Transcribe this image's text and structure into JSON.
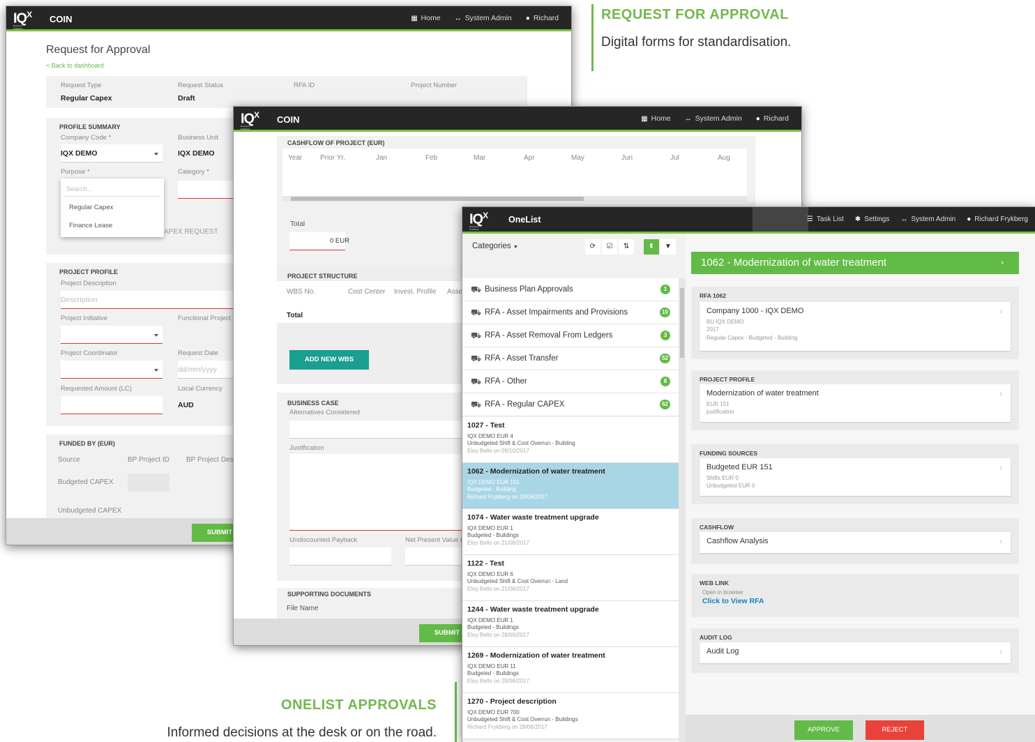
{
  "heading_rfa": {
    "title": "REQUEST FOR APPROVAL",
    "subtitle": "Digital forms for standardisation."
  },
  "heading_onelist": {
    "title": "ONELIST APPROVALS",
    "subtitle": "Informed decisions at the desk or on the road."
  },
  "colors": {
    "accent": "#62bb46",
    "heading": "#72b84e",
    "topbar": "#262626",
    "selected": "#a9d6e5",
    "reject": "#e8423a"
  },
  "coin": {
    "app_title": "COIN",
    "nav": {
      "home": "Home",
      "admin": "System Admin",
      "user": "Richard"
    },
    "logo": "IQ",
    "logo_sup": "X",
    "logo_tag": "Business Solutions"
  },
  "rfa_form": {
    "title": "Request for Approval",
    "back": "< Back to dashboard",
    "request_type_label": "Request Type",
    "request_type": "Regular Capex",
    "status_label": "Request Status",
    "status": "Draft",
    "rfa_id_label": "RFA ID",
    "project_number_label": "Project Number",
    "profile_summary": "PROFILE SUMMARY",
    "company_code_label": "Company Code *",
    "company_code": "IQX DEMO",
    "business_unit_label": "Business Unit",
    "business_unit": "IQX DEMO",
    "purpose_label": "Purpose *",
    "category_label": "Category *",
    "search_placeholder": "Search...",
    "options": [
      "Regular Capex",
      "Finance Lease"
    ],
    "capex_request_suffix": "APEX REQUEST",
    "project_profile": "PROJECT PROFILE",
    "project_description_label": "Project Description",
    "description_placeholder": "Description",
    "project_initiative_label": "Project Initiative",
    "functional_project_label": "Functional Project",
    "project_coordinator_label": "Project Coordinator",
    "request_date_label": "Request Date",
    "date_placeholder": "dd/mm/yyyy",
    "requested_amount_label": "Requested Amount (LC)",
    "local_currency_label": "Local Currency",
    "local_currency": "AUD",
    "funded_by": "FUNDED BY (EUR)",
    "source_col": "Source",
    "bp_project_id_col": "BP Project ID",
    "bp_project_desc_col": "BP Project Descri",
    "budgeted_capex": "Budgeted CAPEX",
    "unbudgeted_capex": "Unbudgeted CAPEX",
    "submit": "SUBMIT"
  },
  "cashflow_form": {
    "cashflow_title": "CASHFLOW OF PROJECT (EUR)",
    "columns": [
      "Year",
      "Prior Yr.",
      "Jan",
      "Feb",
      "Mar",
      "Apr",
      "May",
      "Jun",
      "Jul",
      "Aug"
    ],
    "total_label": "Total",
    "total_value": "0 EUR",
    "project_structure": "PROJECT STRUCTURE",
    "structure_cols": [
      "WBS No.",
      "Cost Center",
      "Invest. Profile",
      "Asse"
    ],
    "structure_total": "Total",
    "add_wbs": "ADD NEW WBS",
    "business_case": "BUSINESS CASE",
    "alternatives_label": "Alternatives Considered",
    "justification_label": "Justification",
    "payback_label": "Undiscounted Payback",
    "npv_label": "Net Present Value (",
    "supporting_docs": "SUPPORTING DOCUMENTS",
    "file_name_label": "File Name",
    "submit": "SUBMIT"
  },
  "onelist": {
    "app_title": "OneList",
    "nav": {
      "tasklist": "Task List",
      "settings": "Settings",
      "admin": "System Admin",
      "user": "Richard Frykberg"
    },
    "categories_label": "Categories",
    "categories": [
      {
        "label": "Business Plan Approvals",
        "count": "1"
      },
      {
        "label": "RFA - Asset Impairments and Provisions",
        "count": "10"
      },
      {
        "label": "RFA - Asset Removal From Ledgers",
        "count": "3"
      },
      {
        "label": "RFA - Asset Transfer",
        "count": "52"
      },
      {
        "label": "RFA - Other",
        "count": "8"
      },
      {
        "label": "RFA - Regular CAPEX",
        "count": "62"
      }
    ],
    "tasks": [
      {
        "title": "1027 - Test",
        "l1": "IQX DEMO EUR 4",
        "l2": "Unbudgeted Shift & Cost Overrun - Building",
        "l3": "Eloy Bello on 09/10/2017"
      },
      {
        "title": "1062 - Modernization of water treatment",
        "l1": "IQX DEMO EUR 151",
        "l2": "Budgeted - Building",
        "l3": "Richard Frykberg on 20/06/2017"
      },
      {
        "title": "1074 - Water waste treatment upgrade",
        "l1": "IQX DEMO EUR 1",
        "l2": "Budgeted - Buildings",
        "l3": "Eloy Bello on 21/06/2017"
      },
      {
        "title": "1122 - Test",
        "l1": "IQX DEMO EUR 6",
        "l2": "Unbudgeted Shift & Cost Overrun - Land",
        "l3": "Eloy Bello on 21/06/2017"
      },
      {
        "title": "1244 - Water waste treatment upgrade",
        "l1": "IQX DEMO EUR 1",
        "l2": "Budgeted - Buildings",
        "l3": "Eloy Bello on 28/06/2017"
      },
      {
        "title": "1269 - Modernization of water treatment",
        "l1": "IQX DEMO EUR 11",
        "l2": "Budgeted - Buildings",
        "l3": "Eloy Bello on 28/06/2017"
      },
      {
        "title": "1270 - Project description",
        "l1": "IQX DEMO EUR 700",
        "l2": "Unbudgeted Shift & Cost Overrun - Buildings",
        "l3": "Richard Frykberg on 28/06/2017"
      }
    ],
    "detail": {
      "header": "1062 - Modernization of water treatment",
      "rfa_title": "RFA 1062",
      "rfa_main": "Company 1000 - IQX DEMO",
      "rfa_s1": "BU IQX DEMO",
      "rfa_s2": "2017",
      "rfa_s3": "Regular Capex - Budgeted - Building",
      "profile_title": "PROJECT PROFILE",
      "profile_main": "Modernization of water treatment",
      "profile_s1": "EUR 151",
      "profile_s2": "justification",
      "funding_title": "FUNDING SOURCES",
      "funding_main": "Budgeted EUR 151",
      "funding_s1": "Shifts EUR 0",
      "funding_s2": "Unbudgeted EUR 0",
      "cashflow_title": "CASHFLOW",
      "cashflow_main": "Cashflow Analysis",
      "weblink_title": "WEB LINK",
      "weblink_s1": "Open in browser",
      "weblink_link": "Click to View RFA",
      "audit_title": "AUDIT LOG",
      "audit_main": "Audit Log",
      "approve": "APPROVE",
      "reject": "REJECT"
    }
  }
}
